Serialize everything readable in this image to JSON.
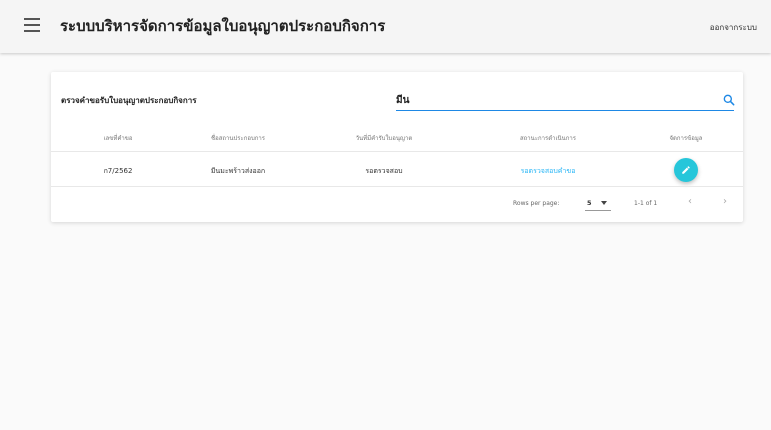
{
  "header": {
    "title": "ระบบบริหารจัดการข้อมูลใบอนุญาตประกอบกิจการ",
    "logout_label": "ออกจากระบบ"
  },
  "card": {
    "title": "ตรวจคำขอรับใบอนุญาตประกอบกิจการ",
    "search": {
      "value": "มีน"
    }
  },
  "table": {
    "columns": [
      "เลขที่คำขอ",
      "ชื่อสถานประกอบการ",
      "วันที่มีคำรับใบอนุญาต",
      "สถานะการดำเนินการ",
      "จัดการข้อมูล"
    ],
    "rows": [
      {
        "request_no": "ก7/2562",
        "business_name": "มีนมะพร้าวส่งออก",
        "date_status": "รอตรวจสอบ",
        "progress": "รอตรวจสอบคำขอ"
      }
    ]
  },
  "pagination": {
    "rows_per_page_label": "Rows per page:",
    "rows_per_page_value": "5",
    "range": "1-1 of 1",
    "prev_icon": "chevron-left-icon",
    "next_icon": "chevron-right-icon"
  },
  "colors": {
    "accent": "#1e88e5",
    "fab": "#26c6da",
    "link": "#29b6f6"
  }
}
